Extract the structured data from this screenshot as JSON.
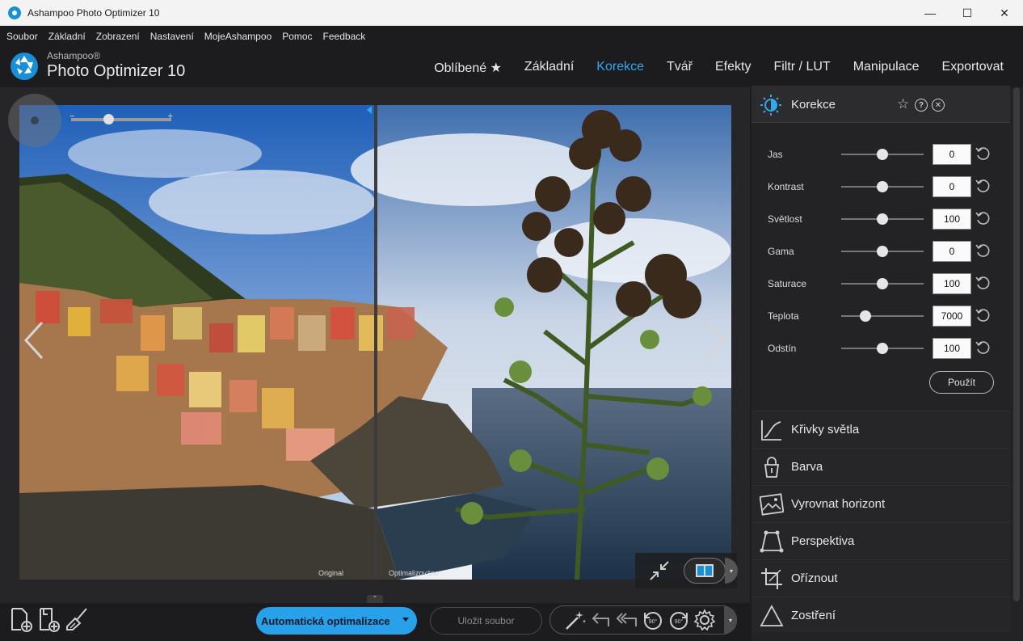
{
  "window": {
    "title": "Ashampoo Photo Optimizer 10",
    "minimize": "—",
    "maximize": "☐",
    "close": "✕"
  },
  "menu": [
    "Soubor",
    "Základní",
    "Zobrazení",
    "Nastavení",
    "MojeAshampoo",
    "Pomoc",
    "Feedback"
  ],
  "brand": {
    "small": "Ashampoo®",
    "big": "Photo Optimizer 10"
  },
  "nav": [
    {
      "label": "Oblíbené ★",
      "active": false
    },
    {
      "label": "Základní",
      "active": false
    },
    {
      "label": "Korekce",
      "active": true
    },
    {
      "label": "Tvář",
      "active": false
    },
    {
      "label": "Efekty",
      "active": false
    },
    {
      "label": "Filtr / LUT",
      "active": false
    },
    {
      "label": "Manipulace",
      "active": false
    },
    {
      "label": "Exportovat",
      "active": false
    }
  ],
  "preview": {
    "label_original": "Original",
    "label_optimized": "Optimalizováno",
    "zoom_minus": "−",
    "zoom_plus": "+",
    "view_dropdown": "▾"
  },
  "bottom": {
    "collapse": "⌃",
    "auto_label": "Automatická optimalizace",
    "save_label": "Uložit soubor",
    "edit_dropdown": "▾"
  },
  "panel": {
    "title": "Korekce",
    "star": "☆",
    "help": "?",
    "close": "✕",
    "adjustments": [
      {
        "label": "Jas",
        "value": "0",
        "position": 0.5
      },
      {
        "label": "Kontrast",
        "value": "0",
        "position": 0.5
      },
      {
        "label": "Světlost",
        "value": "100",
        "position": 0.5
      },
      {
        "label": "Gama",
        "value": "0",
        "position": 0.5
      },
      {
        "label": "Saturace",
        "value": "100",
        "position": 0.5
      },
      {
        "label": "Teplota",
        "value": "7000",
        "position": 0.29
      },
      {
        "label": "Odstín",
        "value": "100",
        "position": 0.5
      }
    ],
    "apply_label": "Použít",
    "sections": [
      {
        "label": "Křivky světla",
        "icon": "curve-icon"
      },
      {
        "label": "Barva",
        "icon": "bucket-icon"
      },
      {
        "label": "Vyrovnat horizont",
        "icon": "horizon-icon"
      },
      {
        "label": "Perspektiva",
        "icon": "perspective-icon"
      },
      {
        "label": "Oříznout",
        "icon": "crop-icon"
      },
      {
        "label": "Zostření",
        "icon": "sharpen-icon"
      }
    ]
  },
  "colors": {
    "accent": "#33a8f0",
    "auto_button": "#29a0ea",
    "background": "#1c1c1e",
    "panel": "#232325"
  }
}
